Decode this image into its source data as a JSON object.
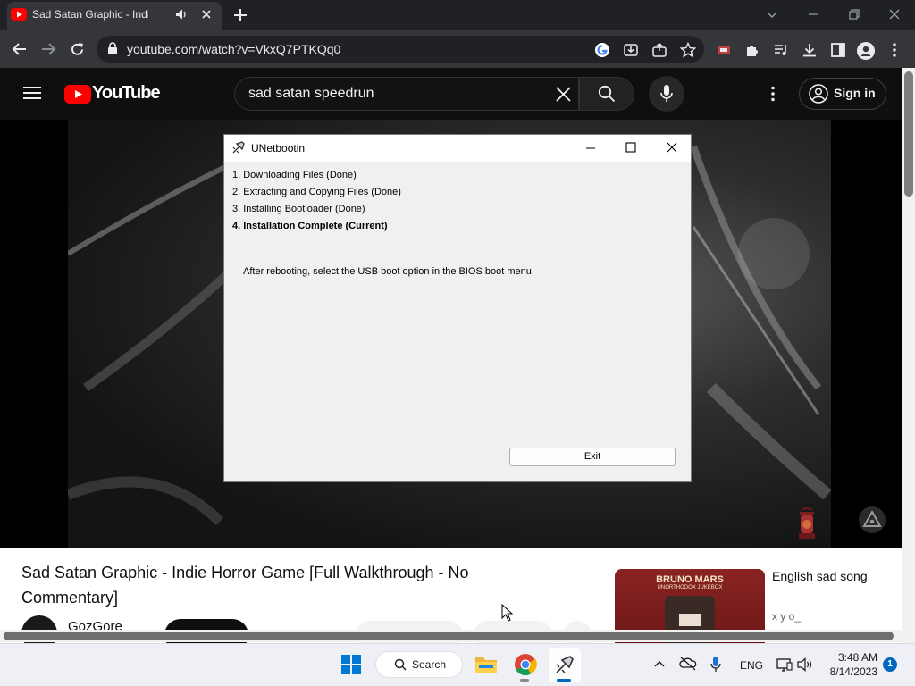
{
  "browser": {
    "tab_title": "Sad Satan Graphic - Indie Horror Game",
    "url": "youtube.com/watch?v=VkxQ7PTKQq0"
  },
  "youtube": {
    "logo_text": "YouTube",
    "search_query": "sad satan speedrun",
    "sign_in_label": "Sign in"
  },
  "dialog": {
    "title": "UNetbootin",
    "steps": [
      "1. Downloading Files (Done)",
      "2. Extracting and Copying Files (Done)",
      "3. Installing Bootloader (Done)",
      "4. Installation Complete (Current)"
    ],
    "message": "After rebooting, select the USB boot option in the BIOS boot menu.",
    "exit_label": "Exit"
  },
  "video": {
    "title": "Sad Satan Graphic - Indie Horror Game [Full Walkthrough - No Commentary]",
    "channel": "GozGore"
  },
  "recommendation": {
    "title": "English sad song",
    "channel": "x y o_",
    "thumb_text_1": "BRUNO MARS",
    "thumb_text_2": "UNORTHODOX JUKEBOX"
  },
  "taskbar": {
    "search_label": "Search",
    "language": "ENG",
    "time": "3:48 AM",
    "date": "8/14/2023",
    "notification_count": "1"
  }
}
